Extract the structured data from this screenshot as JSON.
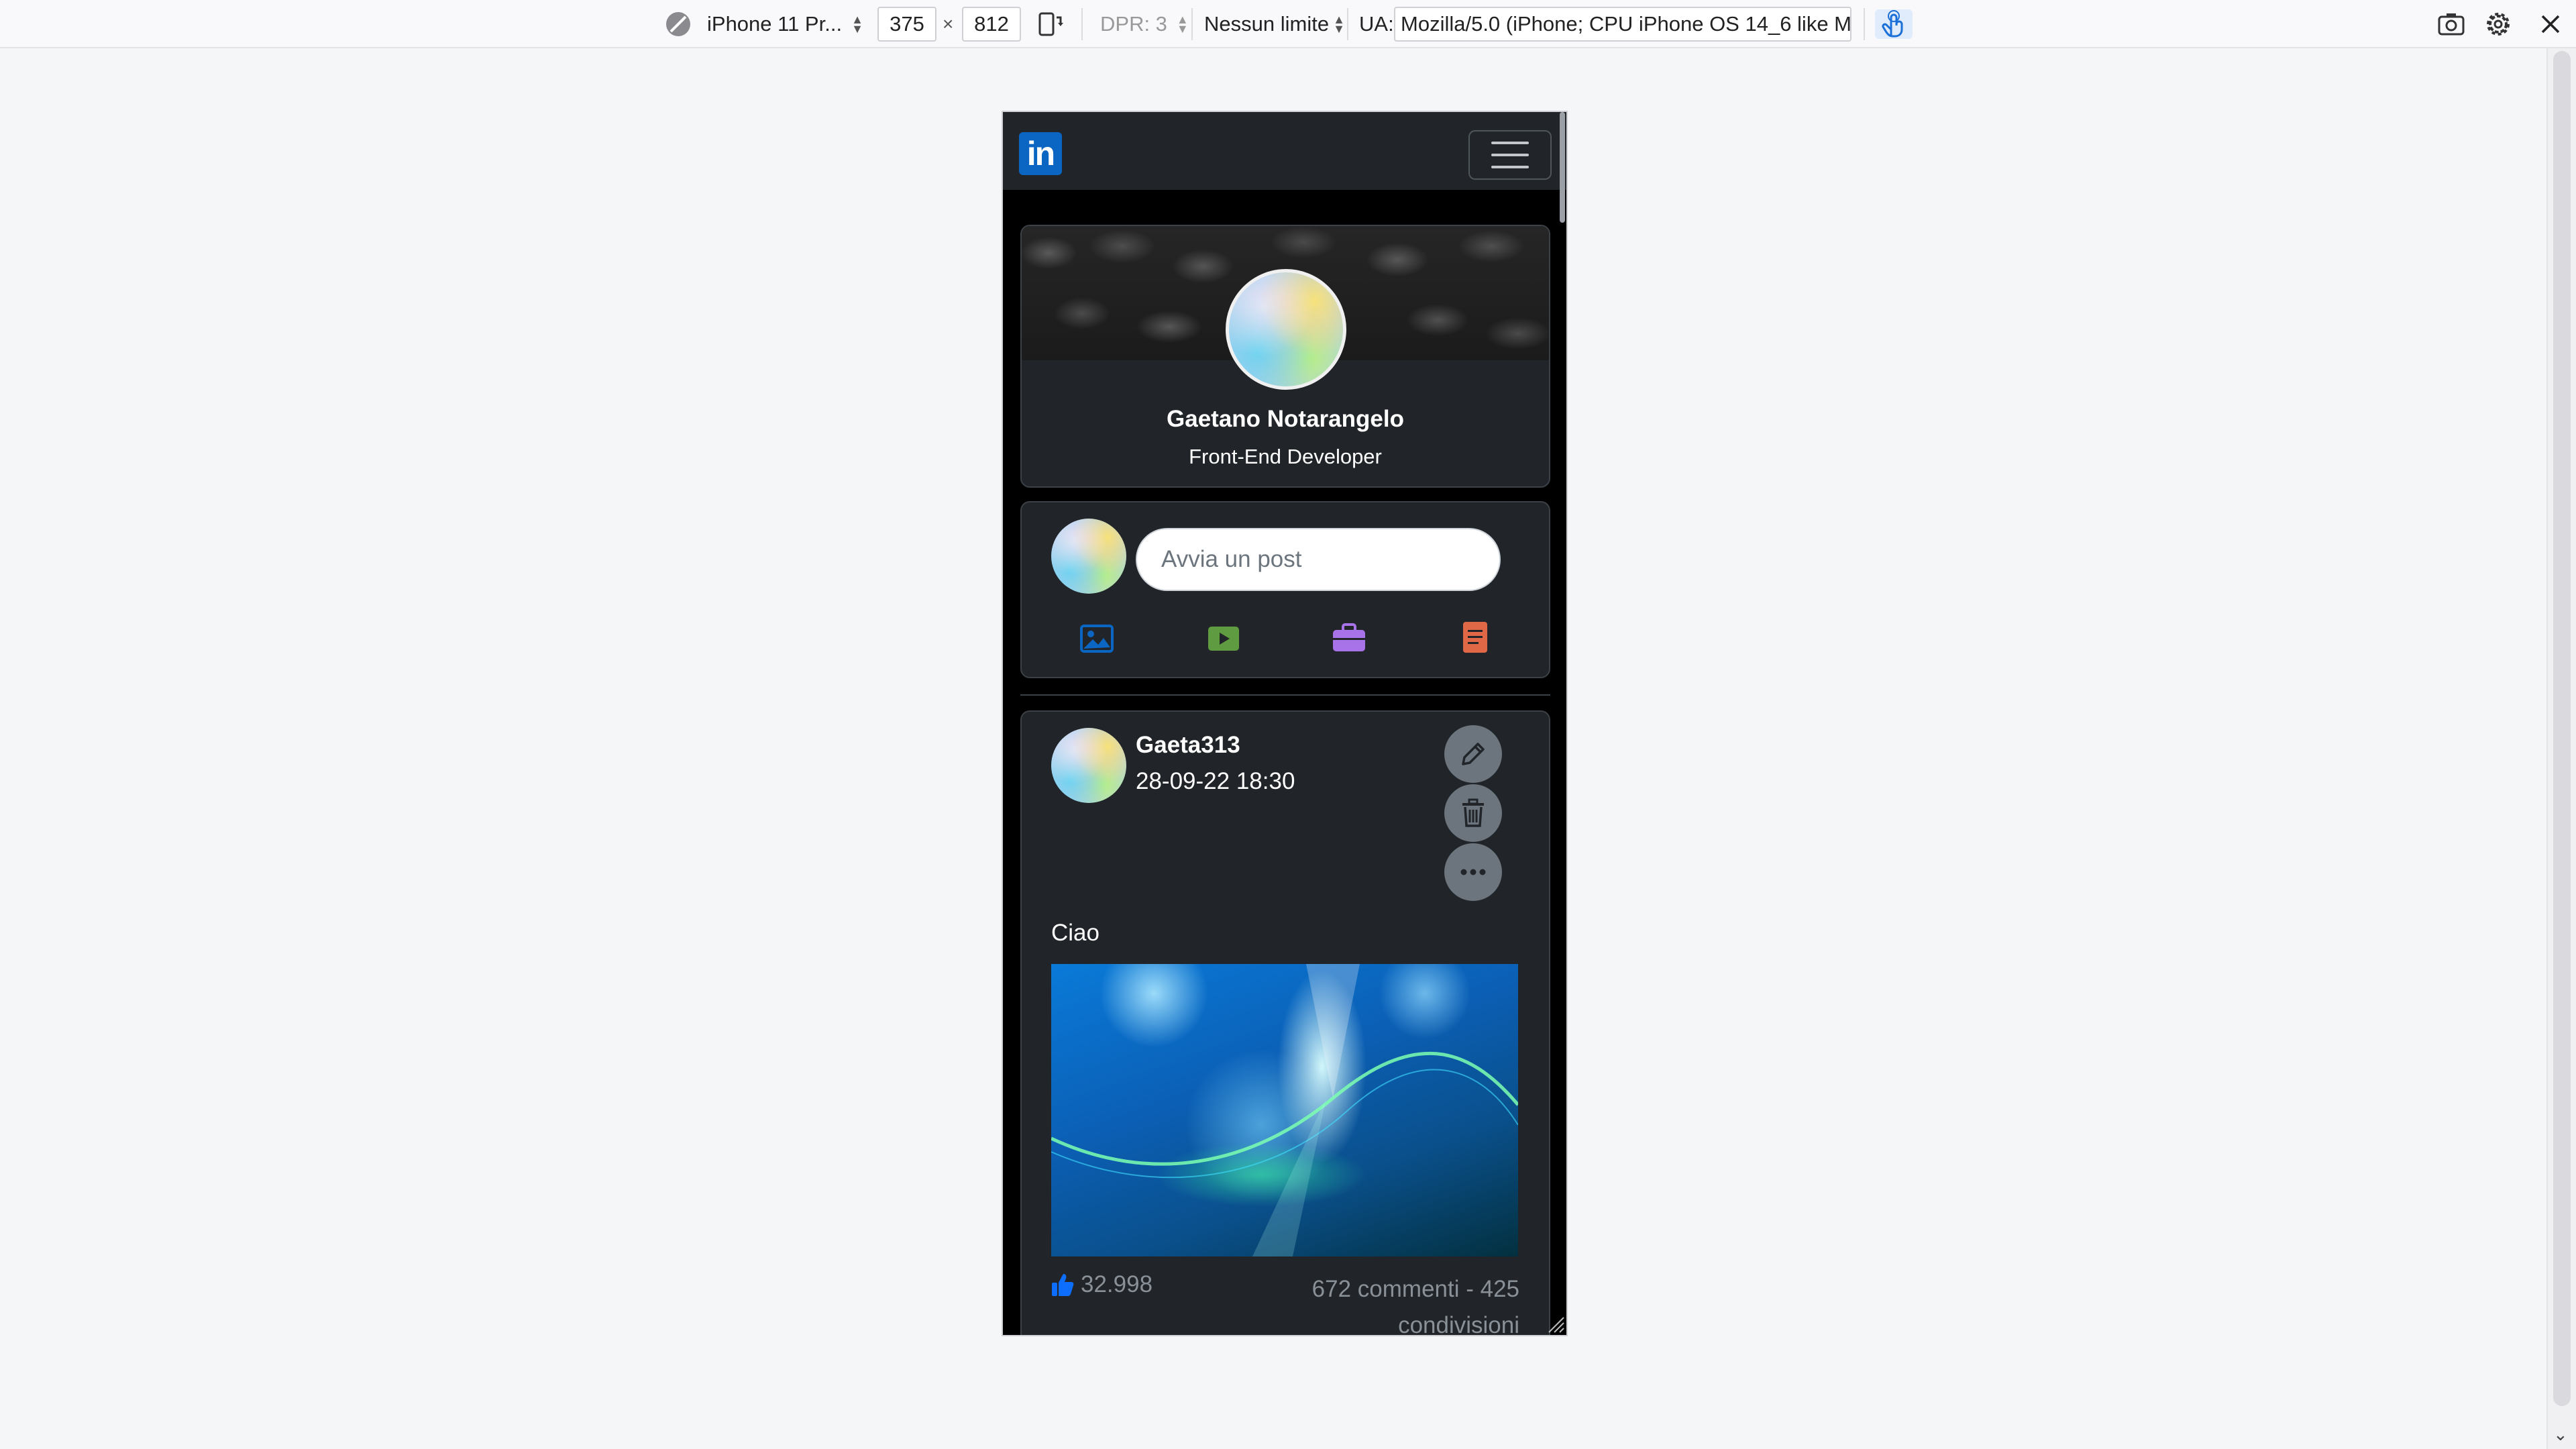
{
  "toolbar": {
    "device": "iPhone 11 Pr...",
    "width": "375",
    "times": "×",
    "height": "812",
    "dpr": "DPR: 3",
    "throttle": "Nessun limite",
    "ua_label": "UA:",
    "ua_value": "Mozilla/5.0 (iPhone; CPU iPhone OS 14_6 like Mac"
  },
  "navbar": {
    "logo_text": "in"
  },
  "profile": {
    "name": "Gaetano Notarangelo",
    "role": "Front-End Developer"
  },
  "composer": {
    "placeholder": "Avvia un post",
    "actions": [
      {
        "icon": "image-icon",
        "color": "#0a66c2"
      },
      {
        "icon": "video-icon",
        "color": "#5f9b41"
      },
      {
        "icon": "briefcase-icon",
        "color": "#a872e8"
      },
      {
        "icon": "article-icon",
        "color": "#e06847"
      }
    ]
  },
  "post": {
    "username": "Gaeta313",
    "timestamp": "28-09-22 18:30",
    "text": "Ciao",
    "likes": "32.998",
    "stats_line1": "672 commenti - 425",
    "stats_line2": "condivisioni"
  },
  "colors": {
    "accent": "#0a66c2",
    "card_bg": "#212529",
    "page_bg": "#000000"
  }
}
